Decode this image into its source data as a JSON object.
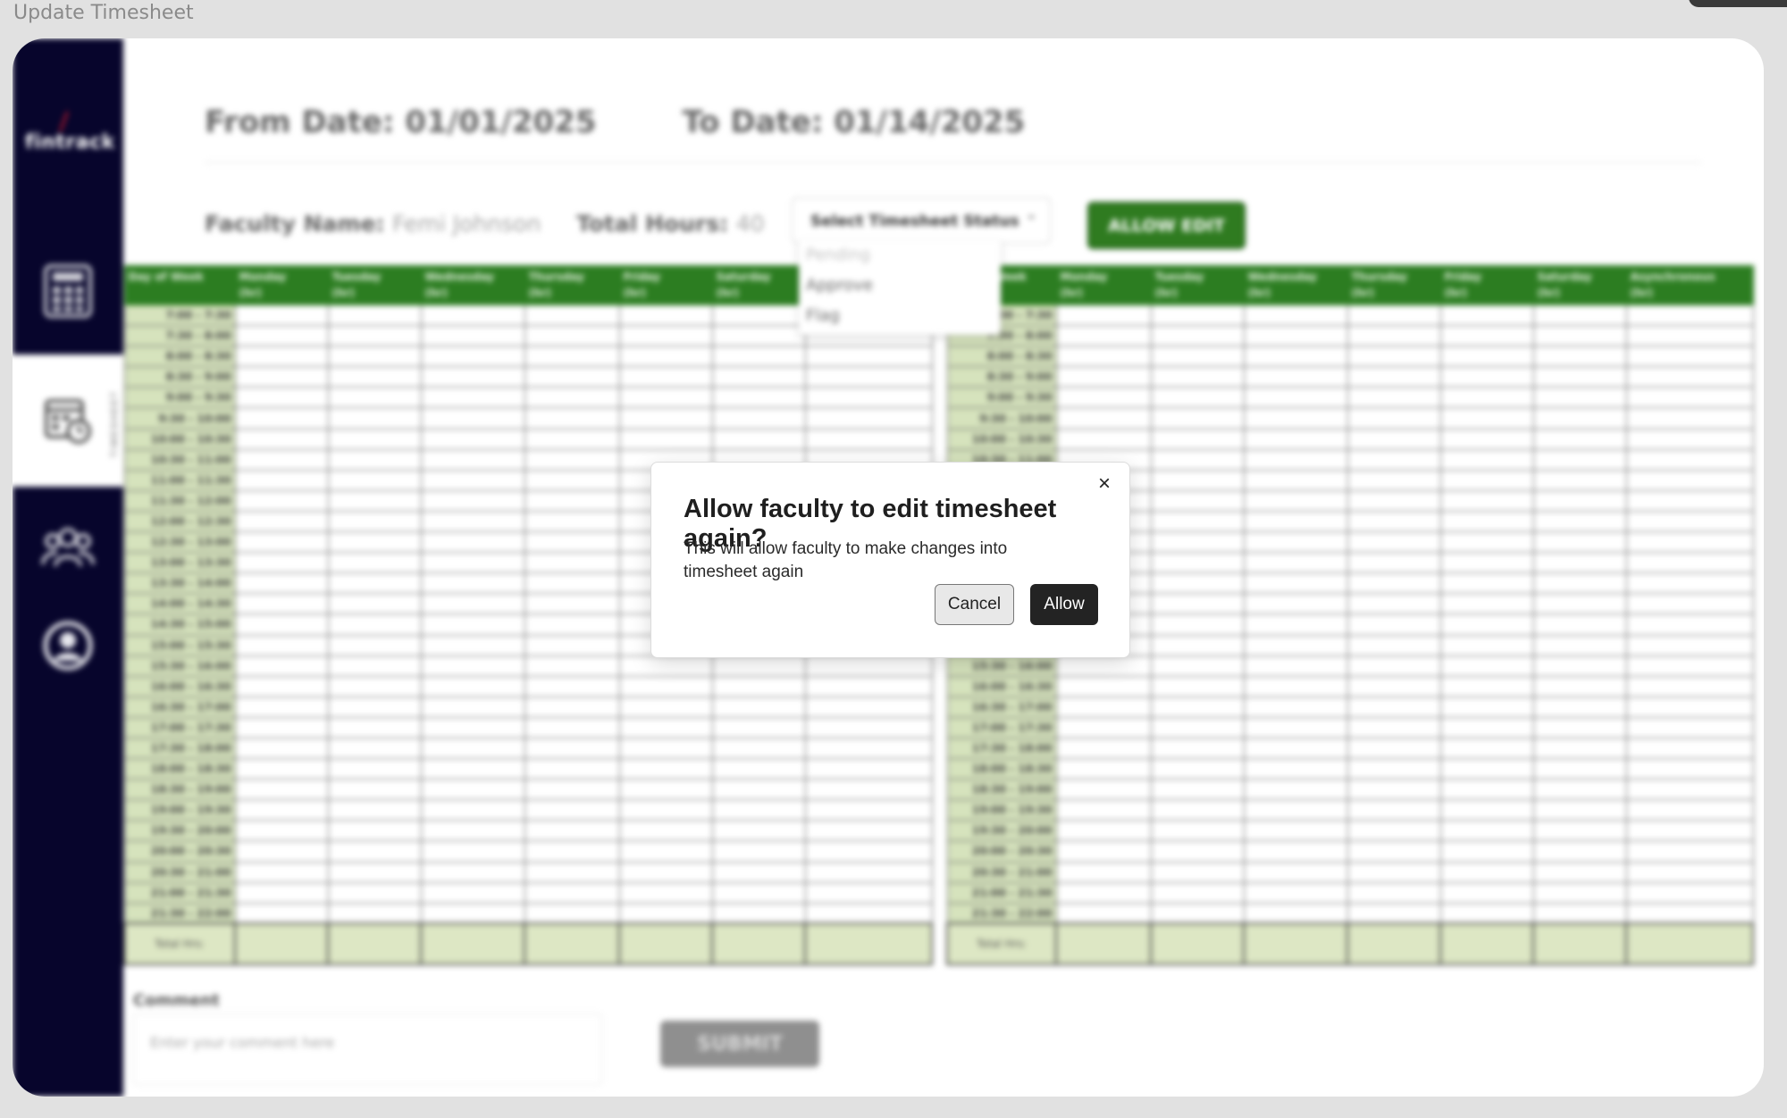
{
  "window_title": "Update Timesheet",
  "sidebar": {
    "logo": "fintrack",
    "items": [
      {
        "icon": "calculator-icon",
        "label": ""
      },
      {
        "icon": "timesheet-icon",
        "label": "TIMESHEET"
      },
      {
        "icon": "users-group-icon",
        "label": ""
      },
      {
        "icon": "user-profile-icon",
        "label": ""
      }
    ]
  },
  "header": {
    "from_date": "From Date: 01/01/2025",
    "to_date": "To Date: 01/14/2025"
  },
  "info": {
    "faculty_label": "Faculty Name:",
    "faculty_value": "Femi Johnson",
    "hours_label": "Total Hours:",
    "hours_value": "40"
  },
  "status_select": {
    "label": "Select Timesheet Status",
    "options": [
      "Pending",
      "Approve",
      "Flag"
    ]
  },
  "allow_edit_button": "ALLOW EDIT",
  "table_left": {
    "headers": [
      {
        "day": "Day of Week",
        "unit": ""
      },
      {
        "day": "Monday",
        "unit": "(hr)"
      },
      {
        "day": "Tuesday",
        "unit": "(hr)"
      },
      {
        "day": "Wednesday",
        "unit": "(hr)"
      },
      {
        "day": "Thursday",
        "unit": "(hr)"
      },
      {
        "day": "Friday",
        "unit": "(hr)"
      },
      {
        "day": "Saturday",
        "unit": "(hr)"
      },
      {
        "day": "",
        "unit": ""
      }
    ]
  },
  "table_right": {
    "headers": [
      {
        "day": "Day of Week",
        "unit": ""
      },
      {
        "day": "Monday",
        "unit": "(hr)"
      },
      {
        "day": "Tuesday",
        "unit": "(hr)"
      },
      {
        "day": "Wednesday",
        "unit": "(hr)"
      },
      {
        "day": "Thursday",
        "unit": "(hr)"
      },
      {
        "day": "Friday",
        "unit": "(hr)"
      },
      {
        "day": "Saturday",
        "unit": "(hr)"
      },
      {
        "day": "Asynchronous",
        "unit": "(hr)"
      }
    ]
  },
  "time_slots": [
    "7:00 - 7:30",
    "7:30 - 8:00",
    "8:00 - 8:30",
    "8:30 - 9:00",
    "9:00 - 9:30",
    "9:30 - 10:00",
    "10:00 - 10:30",
    "10:30 - 11:00",
    "11:00 - 11:30",
    "11:30 - 12:00",
    "12:00 - 12:30",
    "12:30 - 13:00",
    "13:00 - 13:30",
    "13:30 - 14:00",
    "14:00 - 14:30",
    "14:30 - 15:00",
    "15:00 - 15:30",
    "15:30 - 16:00",
    "16:00 - 16:30",
    "16:30 - 17:00",
    "17:00 - 17:30",
    "17:30 - 18:00",
    "18:00 - 18:30",
    "18:30 - 19:00",
    "19:00 - 19:30",
    "19:30 - 20:00",
    "20:00 - 20:30",
    "20:30 - 21:00",
    "21:00 - 21:30",
    "21:30 - 22:00"
  ],
  "total_label": "Total Hrs:",
  "comment": {
    "label": "Comment",
    "placeholder": "Enter your comment here"
  },
  "submit_button": "SUBMIT",
  "modal": {
    "title": "Allow faculty to edit timesheet again?",
    "message": "This will allow faculty to make changes into timesheet again",
    "cancel": "Cancel",
    "allow": "Allow"
  },
  "colors": {
    "sidebar_bg": "#07052c",
    "header_green": "#2c7d21",
    "slot_bg": "#d6e3bd",
    "allow_btn": "#232323"
  }
}
